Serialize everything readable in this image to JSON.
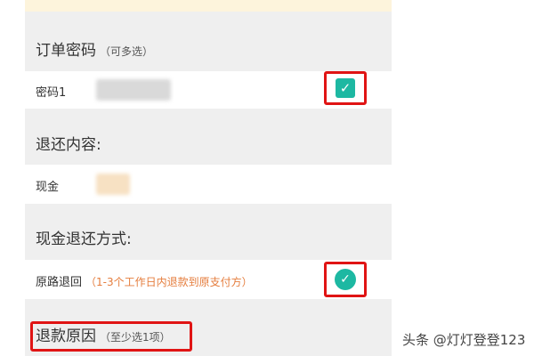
{
  "order_password": {
    "title": "订单密码",
    "hint": "（可多选）",
    "row_label": "密码1",
    "checked": true
  },
  "refund_content": {
    "title": "退还内容:",
    "row_label": "现金"
  },
  "refund_method": {
    "title": "现金退还方式:",
    "option_label": "原路退回",
    "option_note": "（1-3个工作日内退款到原支付方）",
    "selected": true
  },
  "refund_reason": {
    "title": "退款原因",
    "hint": "（至少选1项）"
  },
  "watermark": "头条 @灯灯登登123",
  "colors": {
    "accent": "#1db8a2",
    "highlight": "#e01414",
    "note": "#e57d3d"
  },
  "icons": {
    "checkbox": "check-square-icon",
    "radio": "check-circle-icon"
  }
}
